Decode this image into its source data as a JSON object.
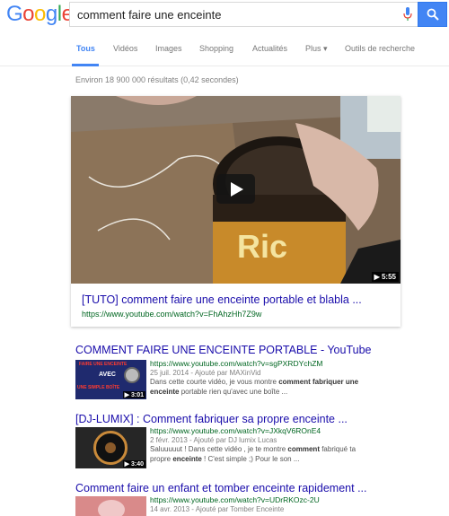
{
  "logo": {
    "text": "Google"
  },
  "search": {
    "query": "comment faire une enceinte"
  },
  "tabs": [
    {
      "label": "Tous"
    },
    {
      "label": "Vidéos"
    },
    {
      "label": "Images"
    },
    {
      "label": "Shopping"
    },
    {
      "label": "Actualités"
    },
    {
      "label": "Plus ▾"
    },
    {
      "label": "Outils de recherche"
    }
  ],
  "stats": "Environ 18 900 000 résultats (0,42 secondes)",
  "featured": {
    "title": "[TUTO] comment faire une enceinte portable et blabla ...",
    "url": "https://www.youtube.com/watch?v=FhAhzHh7Z9w",
    "duration": "5:55"
  },
  "results": [
    {
      "title": "COMMENT FAIRE UNE ENCEINTE PORTABLE - YouTube",
      "url": "https://www.youtube.com/watch?v=sgPXRDYchZM",
      "meta": "25 juil. 2014 - Ajouté par MAXinVid",
      "snippet_1a": "Dans cette courte vidéo, je vous montre ",
      "snippet_1b": "comment fabriquer une",
      "snippet_2a": "enceinte",
      "snippet_2b": " portable rien qu'avec une boîte ...",
      "duration": "3:01",
      "thumb_text_1": "FAIRE UNE ENCEINTE",
      "thumb_text_2": "AVEC",
      "thumb_text_3": "UNE SIMPLE BOÎTE"
    },
    {
      "title": "[DJ-LUMIX] : Comment fabriquer sa propre enceinte ...",
      "url": "https://www.youtube.com/watch?v=JXkqV6ROnE4",
      "meta": "2 févr. 2013 - Ajouté par DJ lumix Lucas",
      "snippet_1a": "Saluuuuut ! Dans cette vidéo , je te montre ",
      "snippet_1b": "comment",
      "snippet_1c": " fabriqué ta",
      "snippet_2a": "propre ",
      "snippet_2b": "enceinte",
      "snippet_2c": " ! C'est simple ;) Pour le son ...",
      "duration": "3:40"
    },
    {
      "title": "Comment faire un enfant et tomber enceinte rapidement ...",
      "url": "https://www.youtube.com/watch?v=UDrRKOzc-2U",
      "meta": "14 avr. 2013 - Ajouté par Tomber Enceinte"
    }
  ],
  "colors": {
    "link": "#1a0dab",
    "url": "#006621",
    "accent": "#4285f4"
  }
}
